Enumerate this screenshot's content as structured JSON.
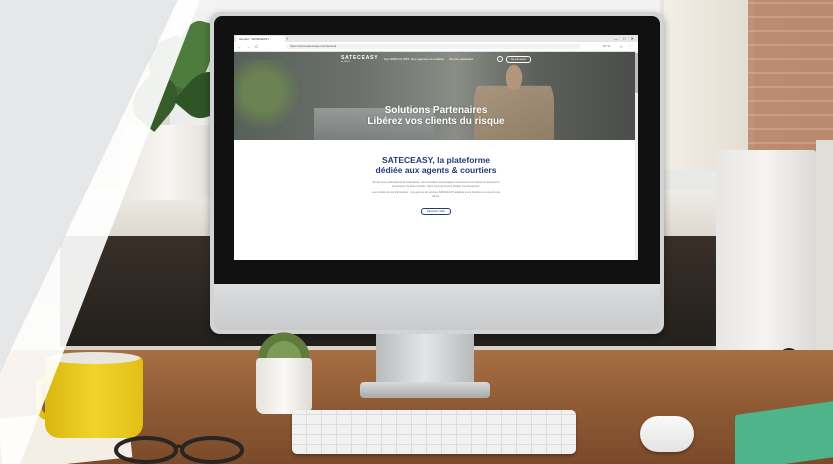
{
  "browser": {
    "tab_title": "Accueil - SATECEASY",
    "new_tab": "+",
    "window_controls": "— □ ✕",
    "nav_buttons": "← → C",
    "url": "https://www.sateceasy.com/accueil",
    "zoom": "67 %",
    "extensions": "☆ ⋮"
  },
  "site": {
    "logo": "SATECEASY",
    "logo_sub": "by SATEC",
    "menu": [
      "Nos SPÉCIALITÉS",
      "Nos agences et contacts",
      "Service partenaire"
    ],
    "cta": "Se connecter",
    "hero_line1": "Solutions Partenaires",
    "hero_line2": "Libérez vos clients du risque",
    "title_line1": "SATECEASY, la plateforme",
    "title_line2": "dédiée aux agents & courtiers",
    "paragraph1": "En tant que professionnel de l'assurance, vous souhaitez accompagner sereinement vos clients en assurant la souscription de leurs contrats. Nous sommes là pour faciliter vos démarches.",
    "paragraph2": "Les contrats de nos Partenaires : une gamme de services SATECEASY adaptée à vos besoins et à ceux de vos clients.",
    "button": "Découvrir l'offre"
  }
}
